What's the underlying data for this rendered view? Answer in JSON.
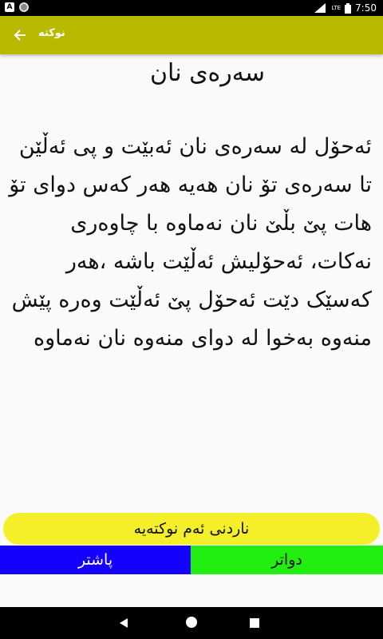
{
  "status_bar": {
    "time": "7:50",
    "notification_badge": "A",
    "signal_label": "LTE"
  },
  "app_bar": {
    "title": "نوکتە",
    "back_icon": "arrow-back-icon"
  },
  "joke": {
    "heading": "سەرەی نان",
    "body": "ئەحۆل لە سەرەی نان ئەبێت و پی ئەڵێن تا سەرەی تۆ نان هەیە هەر کەس دوای تۆ هات پێ بڵێ نان نەماوە با چاوەری نەکات، ئەحۆلیش ئەڵێت باشە ،هەر کەسێک دێت ئەحۆل پێ ئەڵێت وەرە پێش منەوە بەخوا لە دوای منەوە نان نەماوە"
  },
  "actions": {
    "send_label": "ناردنی ئەم نوکتەیە",
    "prev_label": "پاشتر",
    "next_label": "دواتر"
  },
  "colors": {
    "app_bar": "#b9b900",
    "send_button": "#f5ee2a",
    "prev_button": "#1400ff",
    "next_button": "#22ee11"
  }
}
